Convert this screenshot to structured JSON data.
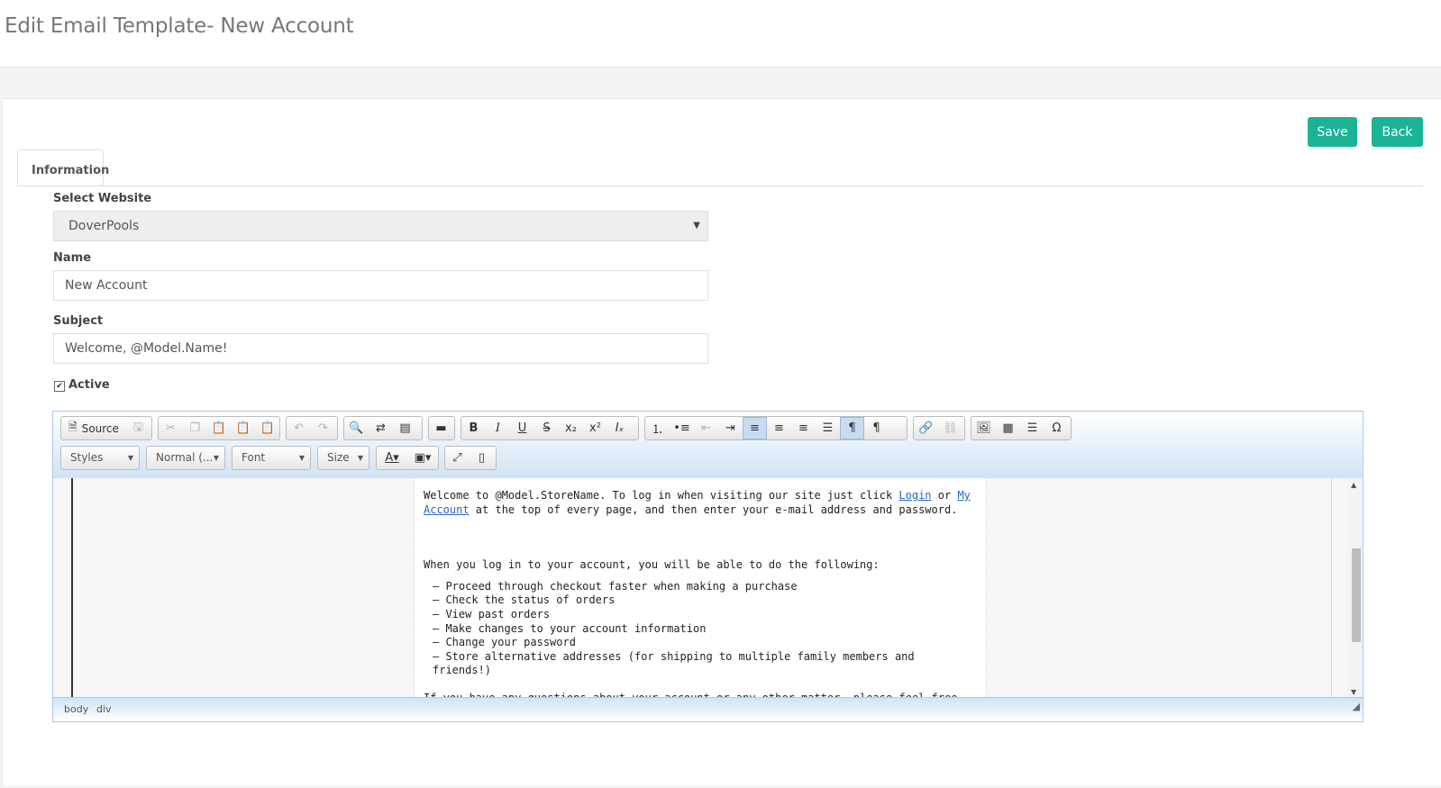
{
  "header": {
    "title": "Edit Email Template- New Account"
  },
  "actions": {
    "save_label": "Save",
    "back_label": "Back"
  },
  "tabs": [
    {
      "label": "Information"
    }
  ],
  "form": {
    "website_label": "Select Website",
    "website_value": "DoverPools",
    "name_label": "Name",
    "name_value": "New Account",
    "subject_label": "Subject",
    "subject_value": "Welcome, @Model.Name!",
    "active_label": "Active"
  },
  "editor": {
    "toolbar": {
      "source_label": "Source",
      "styles_label": "Styles",
      "format_label": "Normal (...",
      "font_label": "Font",
      "size_label": "Size"
    },
    "content": {
      "p1_a": "Welcome to @Model.StoreName. To log in when visiting our site just click ",
      "p1_link1": "Login",
      "p1_b": " or ",
      "p1_link2": "My Account",
      "p1_c": " at the top of every page, and then enter your e-mail address and password.",
      "p2": "When you log in to your account, you will be able to do the following:",
      "list": [
        "Proceed through checkout faster when making a purchase",
        "Check the status of orders",
        "View past orders",
        "Make changes to your account information",
        "Change your password",
        "Store alternative addresses (for shipping to multiple family members and friends!)"
      ],
      "p3": "If you have any questions about your account or any other matter, please feel free to contact us at"
    },
    "status": {
      "crumb1": "body",
      "crumb2": "div"
    }
  },
  "colors": {
    "accent": "#1bb394",
    "link": "#2c64c8"
  }
}
